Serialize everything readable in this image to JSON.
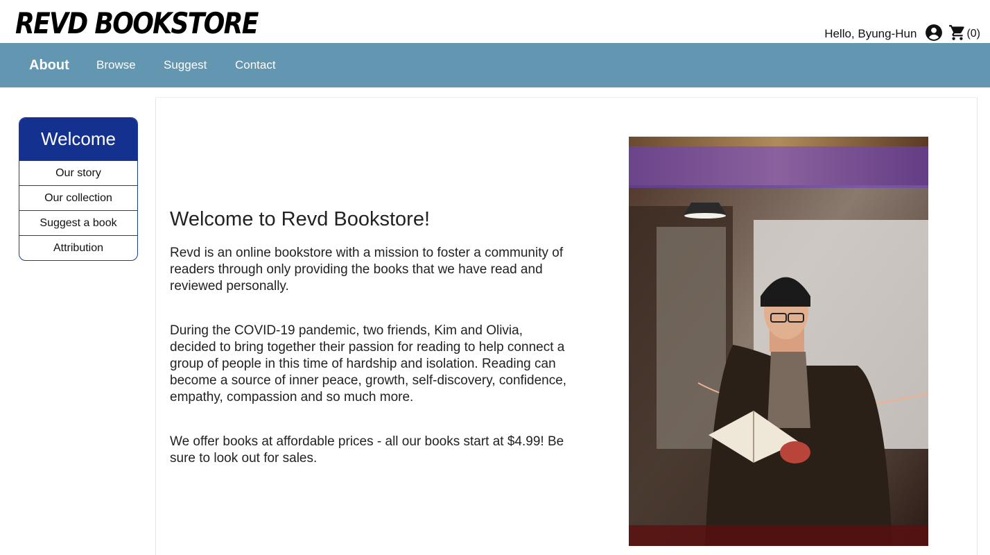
{
  "header": {
    "logo": "REVD BOOKSTORE",
    "greeting": "Hello, Byung-Hun",
    "account_icon": "account-circle-icon",
    "cart_icon": "shopping-cart-icon",
    "cart_count": "(0)"
  },
  "nav": {
    "items": [
      {
        "label": "About",
        "active": true
      },
      {
        "label": "Browse"
      },
      {
        "label": "Suggest"
      },
      {
        "label": "Contact"
      }
    ]
  },
  "sidebar": {
    "title": "Welcome",
    "links": [
      "Our story",
      "Our collection",
      "Suggest a book",
      "Attribution"
    ]
  },
  "main": {
    "title": "Welcome to Revd Bookstore!",
    "paragraphs": [
      "Revd is an online bookstore with a mission to foster a community of readers through only providing the books that we have read and reviewed personally.",
      "During the COVID-19 pandemic, two friends, Kim and Olivia, decided to bring together their passion for reading to help connect a group of people in this time of hardship and isolation. Reading can become a source of inner peace, growth, self-discovery, confidence, empathy, compassion and so much more.",
      "We offer books at affordable prices - all our books start at $4.99! Be sure to look out for sales."
    ]
  },
  "colors": {
    "nav_bg": "#6396b0",
    "sidebar_header": "#14318f",
    "sidebar_border": "#1b3b8f"
  }
}
